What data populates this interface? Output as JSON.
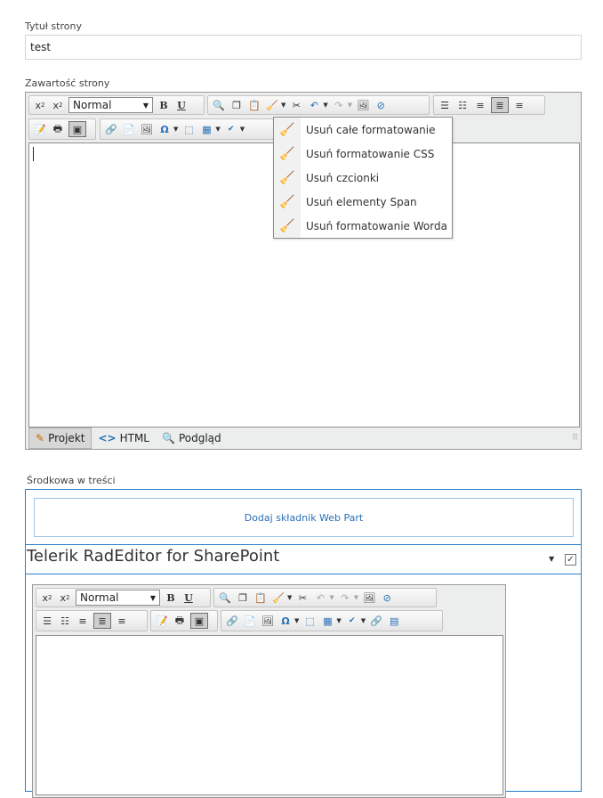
{
  "title_field": {
    "label": "Tytuł strony",
    "value": "test"
  },
  "content_field": {
    "label": "Zawartość strony"
  },
  "toolbar": {
    "format_select_value": "Normal"
  },
  "dropdown": {
    "items": [
      {
        "label": "Usuń całe formatowanie",
        "icon": "broom-icon"
      },
      {
        "label": "Usuń formatowanie CSS",
        "icon": "broom-css-icon"
      },
      {
        "label": "Usuń czcionki",
        "icon": "broom-font-icon"
      },
      {
        "label": "Usuń elementy Span",
        "icon": "broom-span-icon"
      },
      {
        "label": "Usuń formatowanie Worda",
        "icon": "broom-word-icon"
      }
    ]
  },
  "mode_tabs": [
    {
      "label": "Projekt",
      "icon": "pencil-icon",
      "active": true
    },
    {
      "label": "HTML",
      "icon": "code-icon",
      "active": false
    },
    {
      "label": "Podgląd",
      "icon": "magnifier-icon",
      "active": false
    }
  ],
  "zone": {
    "label": "Środkowa w treści",
    "add_webpart_label": "Dodaj składnik Web Part",
    "webpart_title": "Telerik RadEditor for SharePoint",
    "format_select_value": "Normal"
  },
  "colors": {
    "zone_border": "#2a7fcd",
    "link_blue": "#2b6fb6"
  }
}
